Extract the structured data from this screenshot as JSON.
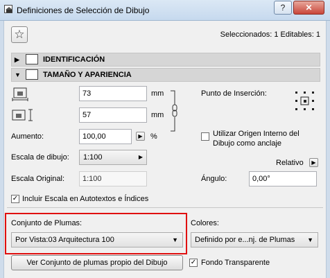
{
  "window": {
    "title": "Definiciones de Selección de Dibujo",
    "help_label": "?",
    "close_label": "✕"
  },
  "status": {
    "selected_text": "Seleccionados: 1 Editables: 1"
  },
  "sections": {
    "identificacion": "IDENTIFICACIÓN",
    "tamano": "TAMAÑO Y APARIENCIA"
  },
  "size": {
    "width_value": "73",
    "width_unit": "mm",
    "height_value": "57",
    "height_unit": "mm"
  },
  "aumento": {
    "label": "Aumento:",
    "value": "100,00",
    "unit": "%"
  },
  "escala": {
    "label": "Escala de dibujo:",
    "value": "1:100"
  },
  "escala_original": {
    "label": "Escala Original:",
    "value": "1:100"
  },
  "insertion": {
    "label": "Punto de Inserción:"
  },
  "origin_checkbox": {
    "label_line1": "Utilizar Origen Interno del",
    "label_line2": "Dibujo como anclaje",
    "checked": false
  },
  "relativo": {
    "label": "Relativo"
  },
  "angulo": {
    "label": "Ángulo:",
    "value": "0,00°"
  },
  "incluir_escala": {
    "label": "Incluir Escala en Autotextos e Índices",
    "checked": true
  },
  "plumas": {
    "label": "Conjunto de Plumas:",
    "value": "Por Vista:03 Arquitectura 100",
    "highlight_color": "#e01010"
  },
  "colores": {
    "label": "Colores:",
    "value": "Definido por e...nj. de Plumas"
  },
  "ver_conjunto_button": "Ver Conjunto de plumas propio del Dibujo",
  "fondo": {
    "label": "Fondo Transparente",
    "checked": true
  }
}
